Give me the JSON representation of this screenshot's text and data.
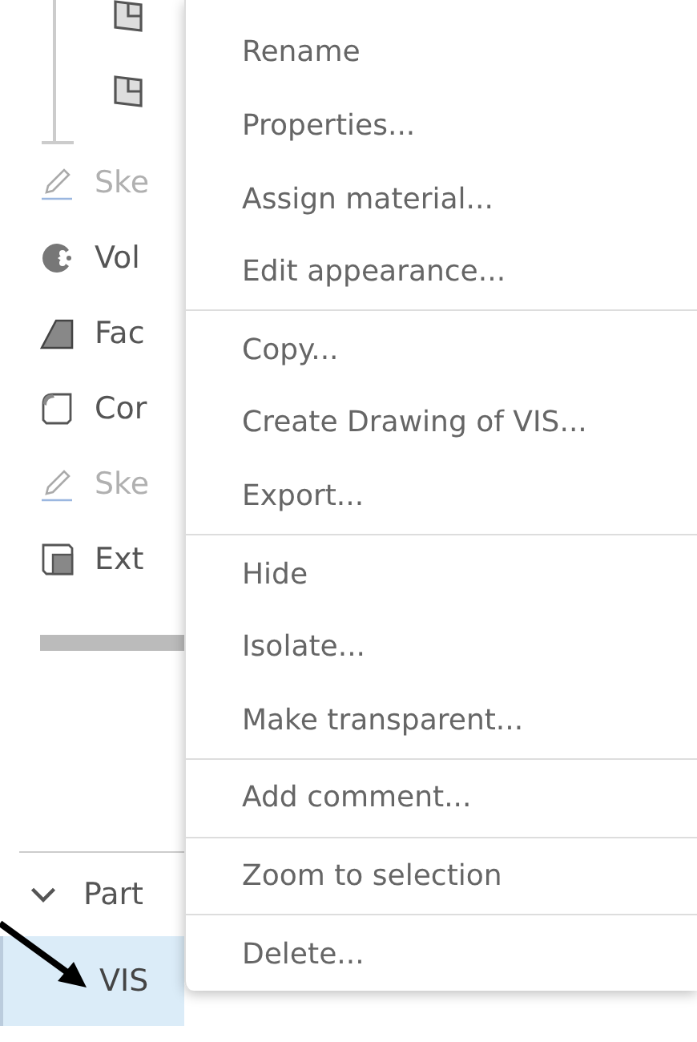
{
  "tree": {
    "children": [
      {
        "kind": "plane"
      },
      {
        "kind": "plane"
      }
    ],
    "items": [
      {
        "kind": "sketch",
        "label": "Ske",
        "disabled": true
      },
      {
        "kind": "revolve",
        "label": "Vol",
        "disabled": false
      },
      {
        "kind": "face",
        "label": "Fac",
        "disabled": false
      },
      {
        "kind": "fillet",
        "label": "Cor",
        "disabled": false
      },
      {
        "kind": "sketch",
        "label": "Ske",
        "disabled": true
      },
      {
        "kind": "extrude",
        "label": "Ext",
        "disabled": false
      }
    ]
  },
  "parts": {
    "label": "Part",
    "expanded": true,
    "items": [
      {
        "label": "VIS",
        "selected": true
      }
    ]
  },
  "context_menu": {
    "groups": [
      [
        "Rename",
        "Properties...",
        "Assign material...",
        "Edit appearance..."
      ],
      [
        "Copy...",
        "Create Drawing of VIS...",
        "Export..."
      ],
      [
        "Hide",
        "Isolate...",
        "Make transparent..."
      ],
      [
        "Add comment..."
      ],
      [
        "Zoom to selection"
      ],
      [
        "Delete..."
      ]
    ]
  }
}
